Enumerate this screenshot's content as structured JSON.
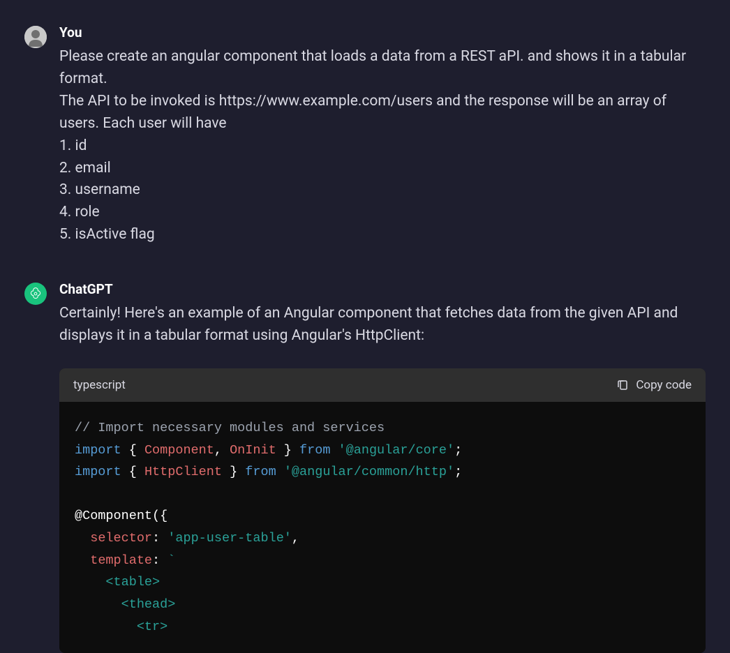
{
  "user_message": {
    "author": "You",
    "lines": [
      "Please create an angular component that loads a data from a REST aPI. and shows it in a tabular format.",
      "The API to be invoked is https://www.example.com/users and the response will be an array of users. Each user will have",
      "1. id",
      "2. email",
      "3. username",
      "4. role",
      "5. isActive flag"
    ]
  },
  "assistant_message": {
    "author": "ChatGPT",
    "intro": "Certainly! Here's an example of an Angular component that fetches data from the given API and displays it in a tabular format using Angular's HttpClient:",
    "code_block": {
      "language": "typescript",
      "copy_label": "Copy code",
      "tokens": [
        [
          {
            "t": "comment",
            "v": "// Import necessary modules and services"
          }
        ],
        [
          {
            "t": "keyword",
            "v": "import"
          },
          {
            "t": "punc",
            "v": " { "
          },
          {
            "t": "class",
            "v": "Component"
          },
          {
            "t": "punc",
            "v": ", "
          },
          {
            "t": "class",
            "v": "OnInit"
          },
          {
            "t": "punc",
            "v": " } "
          },
          {
            "t": "keyword",
            "v": "from"
          },
          {
            "t": "punc",
            "v": " "
          },
          {
            "t": "string",
            "v": "'@angular/core'"
          },
          {
            "t": "punc",
            "v": ";"
          }
        ],
        [
          {
            "t": "keyword",
            "v": "import"
          },
          {
            "t": "punc",
            "v": " { "
          },
          {
            "t": "class",
            "v": "HttpClient"
          },
          {
            "t": "punc",
            "v": " } "
          },
          {
            "t": "keyword",
            "v": "from"
          },
          {
            "t": "punc",
            "v": " "
          },
          {
            "t": "string",
            "v": "'@angular/common/http'"
          },
          {
            "t": "punc",
            "v": ";"
          }
        ],
        [
          {
            "t": "punc",
            "v": ""
          }
        ],
        [
          {
            "t": "decorator",
            "v": "@Component"
          },
          {
            "t": "punc",
            "v": "({"
          }
        ],
        [
          {
            "t": "punc",
            "v": "  "
          },
          {
            "t": "attr",
            "v": "selector"
          },
          {
            "t": "punc",
            "v": ": "
          },
          {
            "t": "string",
            "v": "'app-user-table'"
          },
          {
            "t": "punc",
            "v": ","
          }
        ],
        [
          {
            "t": "punc",
            "v": "  "
          },
          {
            "t": "attr",
            "v": "template"
          },
          {
            "t": "punc",
            "v": ": "
          },
          {
            "t": "string",
            "v": "`"
          }
        ],
        [
          {
            "t": "tag",
            "v": "    <table>"
          }
        ],
        [
          {
            "t": "tag",
            "v": "      <thead>"
          }
        ],
        [
          {
            "t": "tag",
            "v": "        <tr>"
          }
        ]
      ]
    }
  }
}
